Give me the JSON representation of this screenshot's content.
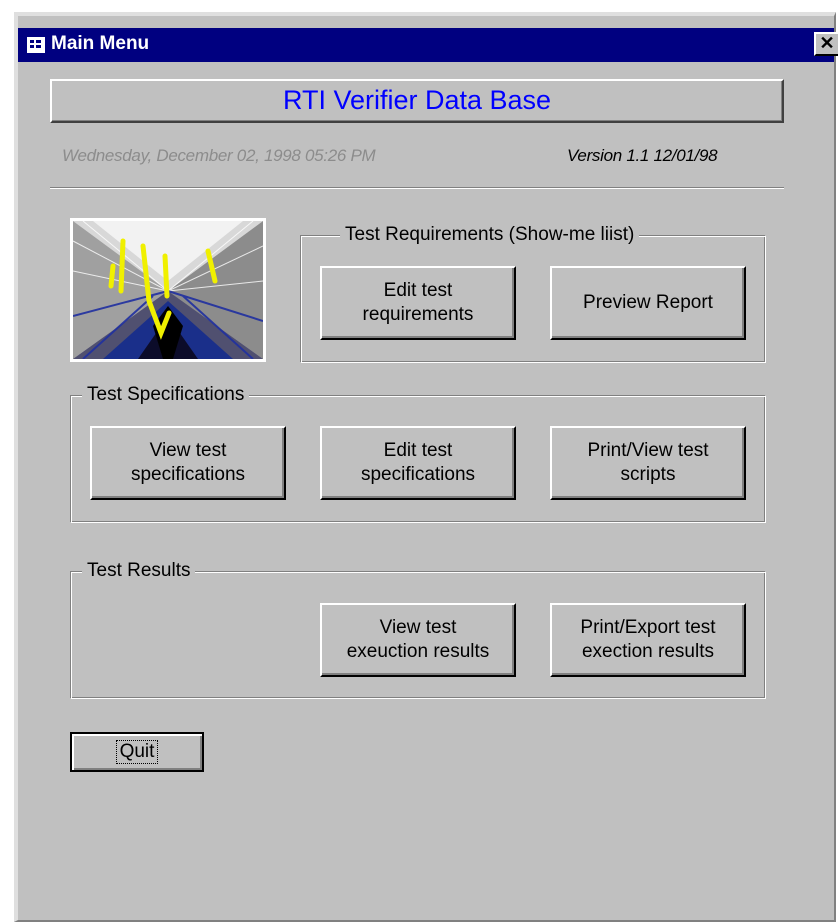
{
  "window": {
    "title": "Main Menu",
    "close_glyph": "✕"
  },
  "header": {
    "banner_title": "RTI Verifier Data Base",
    "banner_color": "#0000ff",
    "date_text": "Wednesday, December 02, 1998 05:26 PM",
    "version_text": "Version 1.1  12/01/98"
  },
  "requirements": {
    "group_label": "Test Requirements (Show-me liist)",
    "edit_button": "Edit test\nrequirements",
    "preview_button": "Preview Report"
  },
  "specifications": {
    "group_label": "Test Specifications",
    "view_button": "View test\nspecifications",
    "edit_button": "Edit test\nspecifications",
    "print_button": "Print/View test\nscripts"
  },
  "results": {
    "group_label": "Test Results",
    "view_button": "View test\nexeuction results",
    "print_button": "Print/Export test\nexection results"
  },
  "footer": {
    "quit_button": "Quit"
  },
  "colors": {
    "title_bar": "#000080",
    "face": "#c0c0c0",
    "date_gray": "#8c8c8c"
  }
}
